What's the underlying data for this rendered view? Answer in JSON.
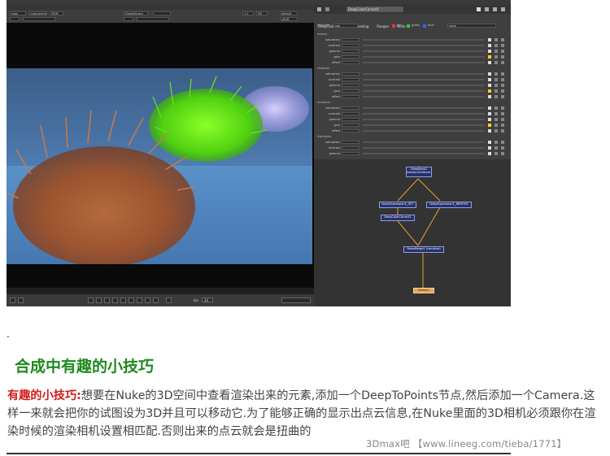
{
  "nuke": {
    "menu": [
      "File",
      "Edit",
      "Layout",
      "Viewer",
      "Render",
      "Cache",
      "Help"
    ],
    "viewer_tab": "Viewer1",
    "toolbar": {
      "channels": "rgba",
      "layer": "rgba.alpha",
      "colorspace": "RGB",
      "node": "DeepMerge1",
      "zoom": "1:1",
      "dim": "3D",
      "lut": "default",
      "input": "sRGB"
    },
    "status_line": "1920x1080 bbox: 0 0 1920 1080 channels: rgba,deep.front,deep.back,deep,Mattes",
    "frame_label": "fps",
    "frame_value": "24",
    "properties": {
      "title": "DeepColorCorrect1",
      "tabs": [
        "DeepColorCorrect",
        "Masking",
        "Ranges",
        "Node"
      ],
      "channels_label": "channels",
      "channels_value": "rgb",
      "channel_toggles": [
        "red",
        "green",
        "blue"
      ],
      "mask_value": "none",
      "sections": [
        {
          "name": "master",
          "rows": [
            "saturation",
            "contrast",
            "gamma",
            "gain",
            "offset"
          ]
        },
        {
          "name": "shadows",
          "rows": [
            "saturation",
            "contrast",
            "gamma",
            "gain",
            "offset"
          ]
        },
        {
          "name": "midtones",
          "rows": [
            "saturation",
            "contrast",
            "gamma",
            "gain",
            "offset"
          ]
        },
        {
          "name": "highlights",
          "rows": [
            "saturation",
            "contrast",
            "gamma"
          ]
        }
      ]
    },
    "nodes": {
      "deepread": "DeepRead1",
      "deepread_file": "beauty.%04d.exr",
      "expr_left": "DeepExpression1_GET",
      "expr_right": "DeepExpression1_REMOVE",
      "colorcorrect": "DeepColorCorrect1",
      "merge": "DeepMerge1 (combine)",
      "viewer": "Viewer1"
    }
  },
  "dot": ".",
  "heading": "合成中有趣的小技巧",
  "paragraph": {
    "lead": "有趣的小技巧:",
    "body": "想要在Nuke的3D空间中查看渲染出来的元素,添加一个DeepToPoints节点,然后添加一个Camera.这样一来就会把你的试图设为3D并且可以移动它.为了能够正确的显示出点云信息,在Nuke里面的3D相机必须跟你在渲染时候的渲染相机设置相匹配.否则出来的点云就会是扭曲的"
  },
  "watermark": "3Dmax吧 【www.lineeg.com/tieba/1771】"
}
